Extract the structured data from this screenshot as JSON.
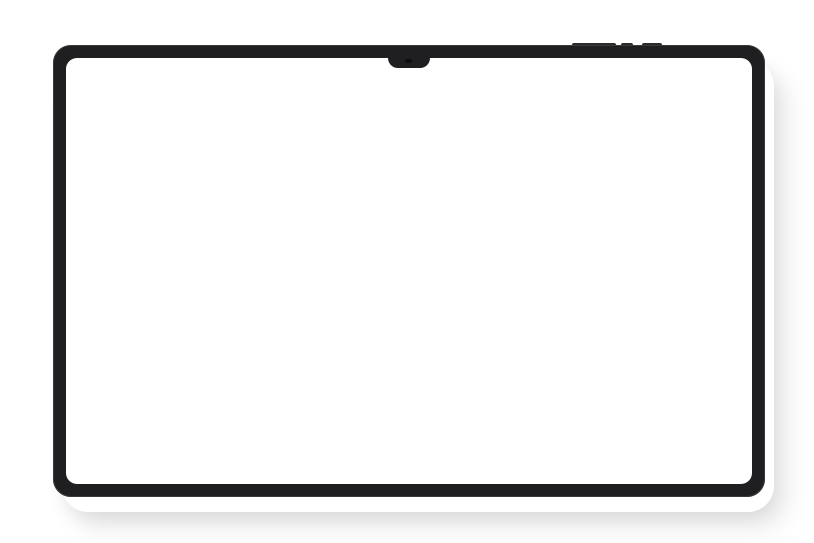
{
  "device": {
    "type": "tablet",
    "frame_color": "#1f1f21",
    "screen_color": "#ffffff",
    "background_color": "#ffffff"
  }
}
